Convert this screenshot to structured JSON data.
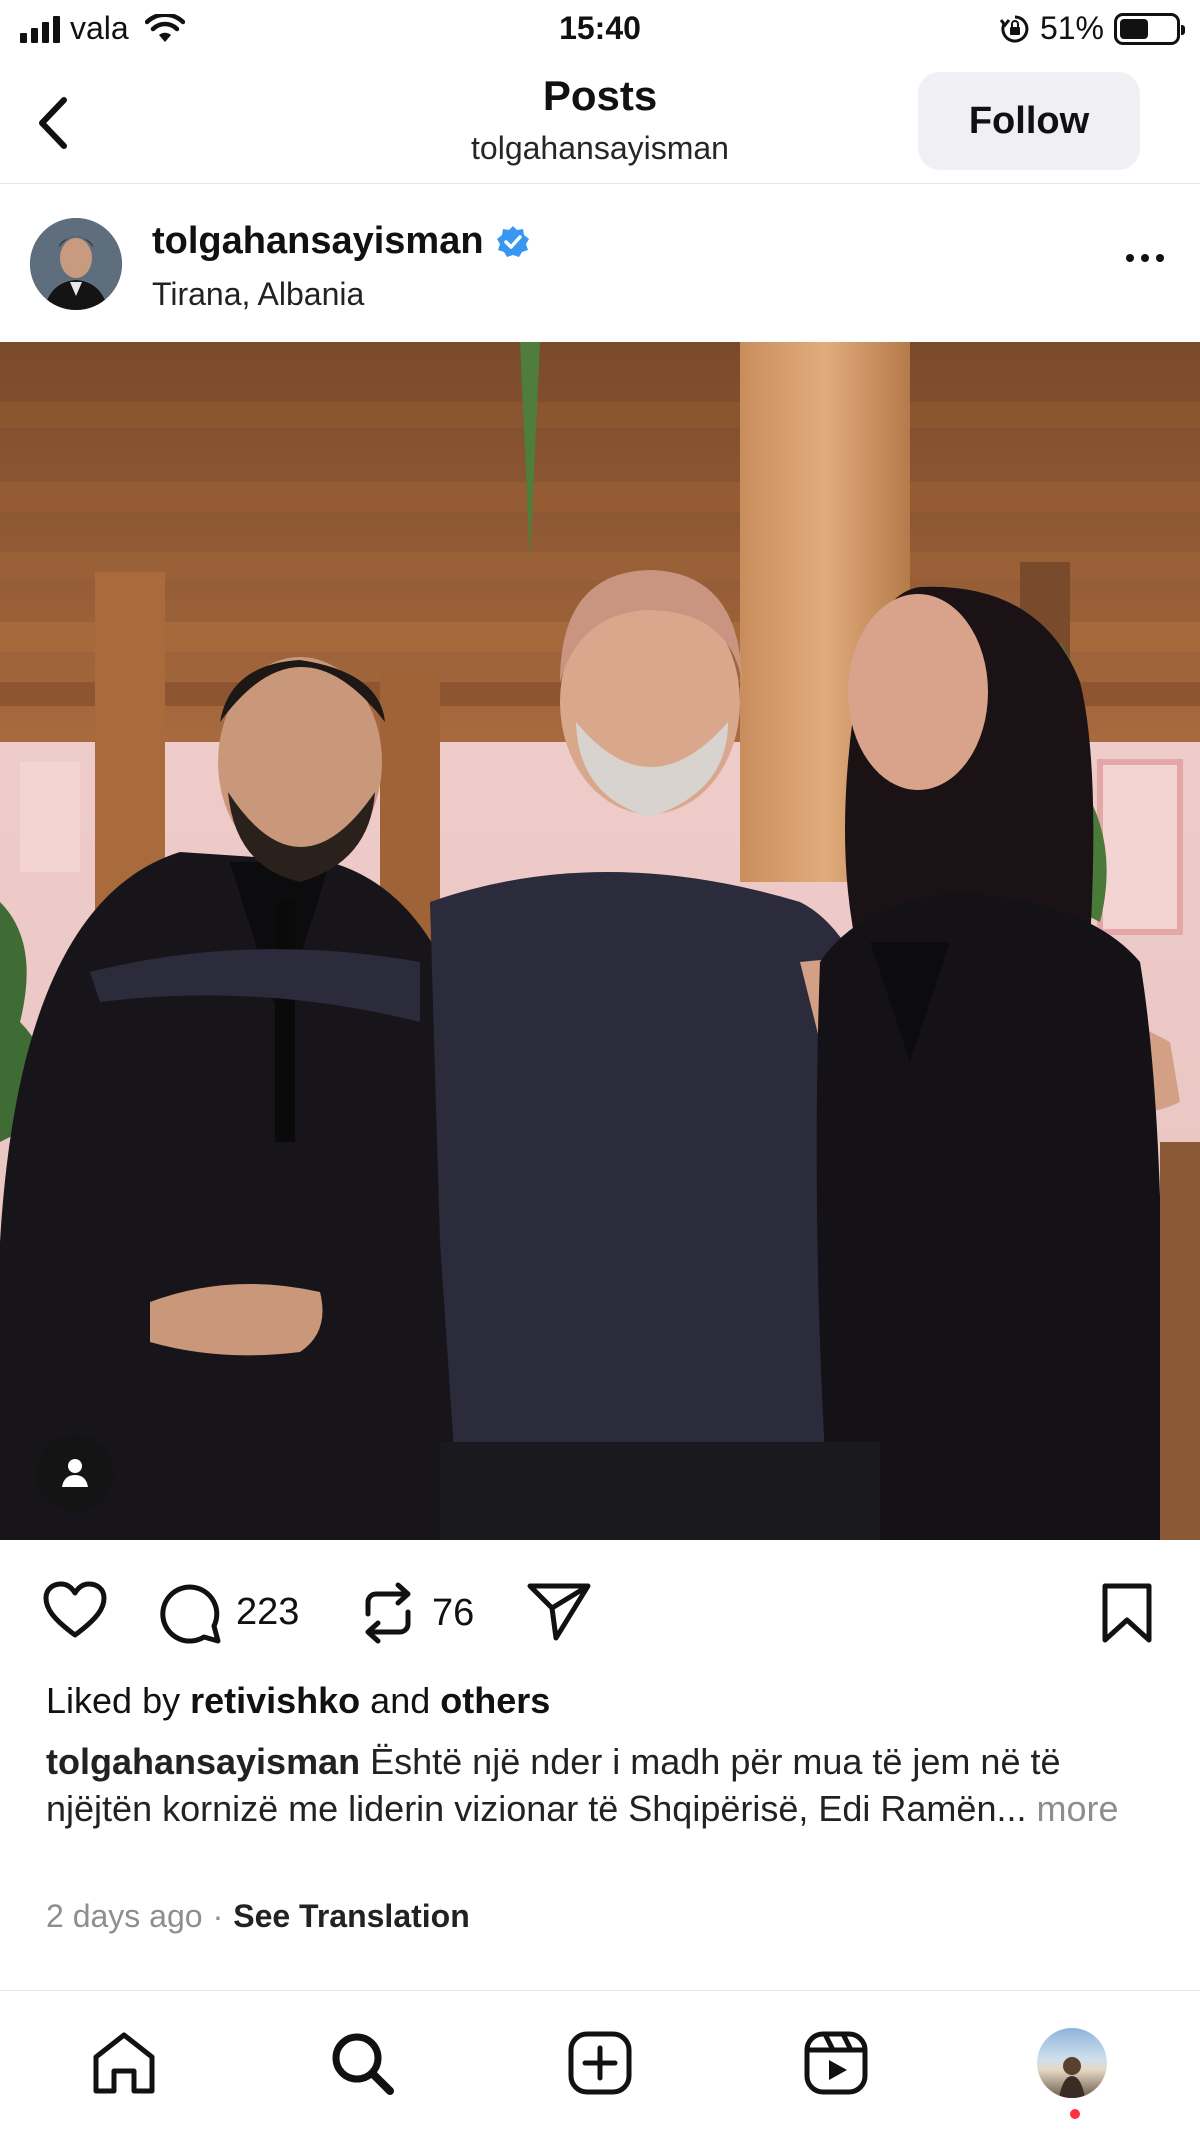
{
  "status_bar": {
    "carrier": "vala",
    "time": "15:40",
    "battery": "51%",
    "battery_level": 0.51,
    "icons": [
      "signal-icon",
      "wifi-icon",
      "orientation-lock-icon",
      "battery-icon"
    ]
  },
  "nav": {
    "title": "Posts",
    "subtitle": "tolgahansayisman",
    "follow_label": "Follow",
    "back_icon": "chevron-left-icon"
  },
  "post": {
    "username": "tolgahansayisman",
    "verified": true,
    "location": "Tirana, Albania",
    "more_icon": "ellipsis-icon",
    "photo_tag_icon": "person-icon"
  },
  "actions": {
    "like_icon": "heart-icon",
    "comment_icon": "comment-icon",
    "comment_count": "223",
    "repost_icon": "repost-icon",
    "repost_count": "76",
    "share_icon": "send-icon",
    "save_icon": "bookmark-icon"
  },
  "likes": {
    "prefix": "Liked by ",
    "user": "retivishko",
    "middle": " and ",
    "suffix": "others"
  },
  "caption": {
    "user": "tolgahansayisman",
    "text": " Është një nder i madh për mua të jem në të njëjtën kornizë me liderin vizionar të Shqipërisë, Edi Ramën...",
    "more": "more"
  },
  "meta": {
    "time": "2 days ago",
    "separator": "·",
    "translate": "See Translation"
  },
  "tabbar": {
    "items": [
      "home-icon",
      "search-icon",
      "create-icon",
      "reels-icon",
      "profile-icon"
    ]
  },
  "colors": {
    "verified": "#3897f0",
    "follow_bg": "#efeff4",
    "muted": "#8e8e8e",
    "notification": "#ff3040"
  }
}
